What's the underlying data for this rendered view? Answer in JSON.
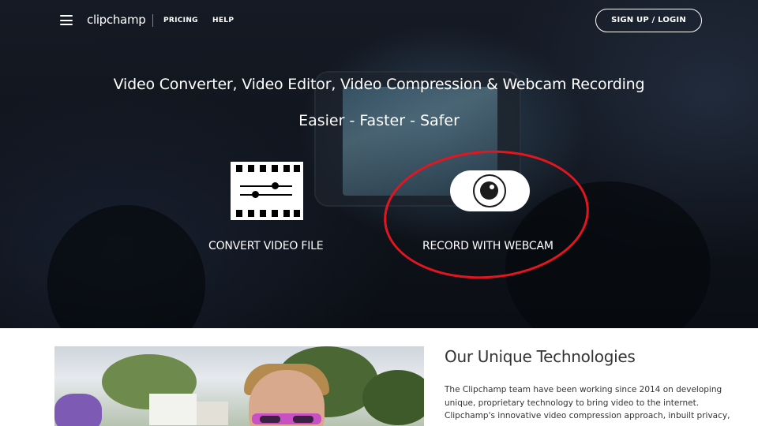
{
  "header": {
    "logo": "clipchamp",
    "nav": [
      "PRICING",
      "HELP"
    ],
    "signup_label": "SIGN UP / LOGIN"
  },
  "hero": {
    "title": "Video Converter, Video Editor, Video Compression & Webcam Recording",
    "subtitle": "Easier - Faster - Safer",
    "options": [
      {
        "label": "CONVERT VIDEO FILE",
        "icon": "film-sliders-icon"
      },
      {
        "label": "RECORD WITH WEBCAM",
        "icon": "webcam-icon"
      }
    ]
  },
  "section": {
    "title": "Our Unique Technologies",
    "body_lines": [
      "The Clipchamp team have been working since 2014 on developing",
      "unique, proprietary technology to bring video to the internet.",
      "Clipchamp's innovative video compression approach, inbuilt privacy,"
    ]
  },
  "colors": {
    "highlight": "#e3161f",
    "hero_bg": "#11151d",
    "text_dark": "#333333"
  }
}
